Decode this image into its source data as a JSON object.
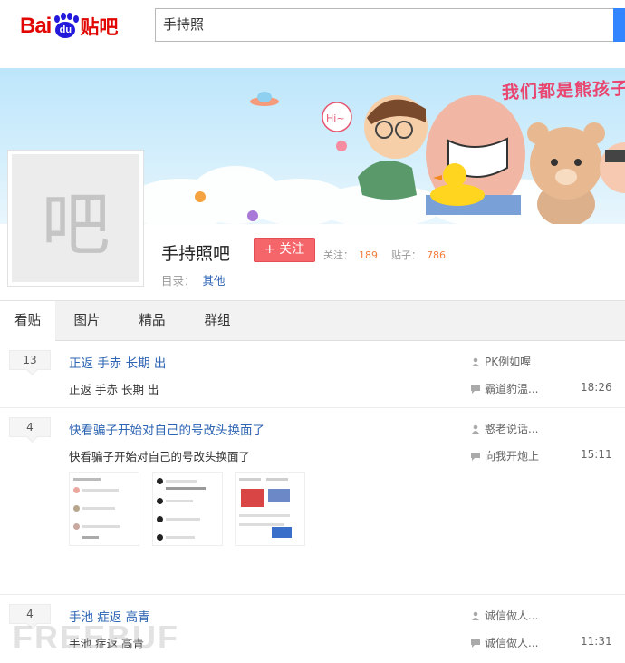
{
  "header": {
    "logo": {
      "bai": "Bai",
      "du": "du",
      "tieba": "贴吧"
    },
    "search": {
      "value": "手持照"
    }
  },
  "banner": {
    "slogan": "我们都是熊孩子"
  },
  "forum": {
    "avatar_char": "吧",
    "name": "手持照吧",
    "follow_label": "+ 关注",
    "followers_label": "关注：",
    "followers_count": "189",
    "posts_label": "贴子：",
    "posts_count": "786",
    "catalog_label": "目录：",
    "catalog_value": "其他"
  },
  "tabs": [
    {
      "label": "看贴",
      "active": true
    },
    {
      "label": "图片",
      "active": false
    },
    {
      "label": "精品",
      "active": false
    },
    {
      "label": "群组",
      "active": false
    }
  ],
  "threads": [
    {
      "reply_count": "13",
      "title": "正返 手赤 长期 出",
      "abstract": "正返 手赤 长期 出",
      "author": "PK例如喔",
      "last_reply_user": "霸道豹温...",
      "last_reply_time": "18:26",
      "has_images": false
    },
    {
      "reply_count": "4",
      "title": "快看骗子开始对自己的号改头换面了",
      "abstract": "快看骗子开始对自己的号改头换面了",
      "author": "憨老说话...",
      "last_reply_user": "向我开炮上",
      "last_reply_time": "15:11",
      "has_images": true
    },
    {
      "reply_count": "4",
      "title": "手池 症返 高青",
      "abstract": "手池 症返 高青",
      "author": "诚信做人...",
      "last_reply_user": "诚信做人...",
      "last_reply_time": "11:31",
      "has_images": false
    }
  ],
  "watermark": "FREEBUF",
  "colors": {
    "brand_red": "#e10601",
    "brand_blue": "#2319dc",
    "link_blue": "#2d64b3",
    "follow_red": "#f5666b",
    "stat_orange": "#f27e3e"
  }
}
